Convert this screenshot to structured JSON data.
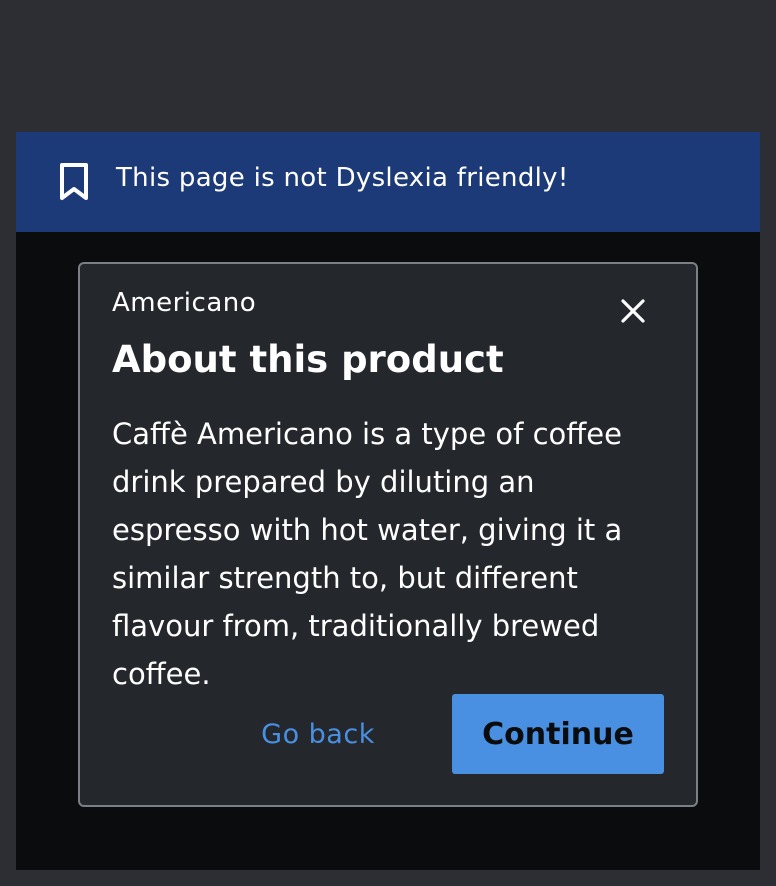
{
  "banner": {
    "icon": "bookmark-icon",
    "text": "This page is not Dyslexia friendly!",
    "background": "#1d3a78"
  },
  "modal": {
    "eyebrow": "Americano",
    "title": "About this product",
    "body": "Caffè Americano is a type of coffee drink prepared by diluting an espresso with hot water, giving it a similar strength to, but different flavour from, traditionally brewed coffee.",
    "close_icon": "close-icon",
    "buttons": {
      "back_label": "Go back",
      "continue_label": "Continue"
    }
  },
  "colors": {
    "accent": "#4a90e2",
    "modal_bg": "#24272c",
    "page_bg": "#0b0c0d"
  }
}
